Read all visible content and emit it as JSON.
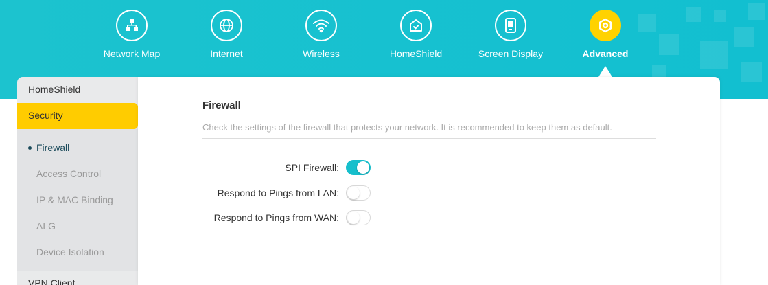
{
  "nav": {
    "items": [
      {
        "label": "Network Map",
        "icon": "network-map-icon"
      },
      {
        "label": "Internet",
        "icon": "globe-icon"
      },
      {
        "label": "Wireless",
        "icon": "wifi-icon"
      },
      {
        "label": "HomeShield",
        "icon": "home-shield-icon"
      },
      {
        "label": "Screen Display",
        "icon": "screen-display-icon"
      },
      {
        "label": "Advanced",
        "icon": "gear-icon",
        "active": true
      }
    ]
  },
  "sidebar": {
    "items": [
      {
        "label": "HomeShield"
      },
      {
        "label": "Security",
        "active": true
      },
      {
        "label": "VPN Client"
      }
    ],
    "security_subitems": [
      {
        "label": "Firewall",
        "active": true
      },
      {
        "label": "Access Control"
      },
      {
        "label": "IP & MAC Binding"
      },
      {
        "label": "ALG"
      },
      {
        "label": "Device Isolation"
      }
    ]
  },
  "firewall": {
    "title": "Firewall",
    "description": "Check the settings of the firewall that protects your network. It is recommended to keep them as default.",
    "settings": [
      {
        "label": "SPI Firewall:",
        "enabled": true
      },
      {
        "label": "Respond to Pings from LAN:",
        "enabled": false
      },
      {
        "label": "Respond to Pings from WAN:",
        "enabled": false
      }
    ]
  },
  "colors": {
    "header": "#1cc3cf",
    "accent_yellow": "#ffcc00",
    "toggle_on": "#16bfcc"
  }
}
